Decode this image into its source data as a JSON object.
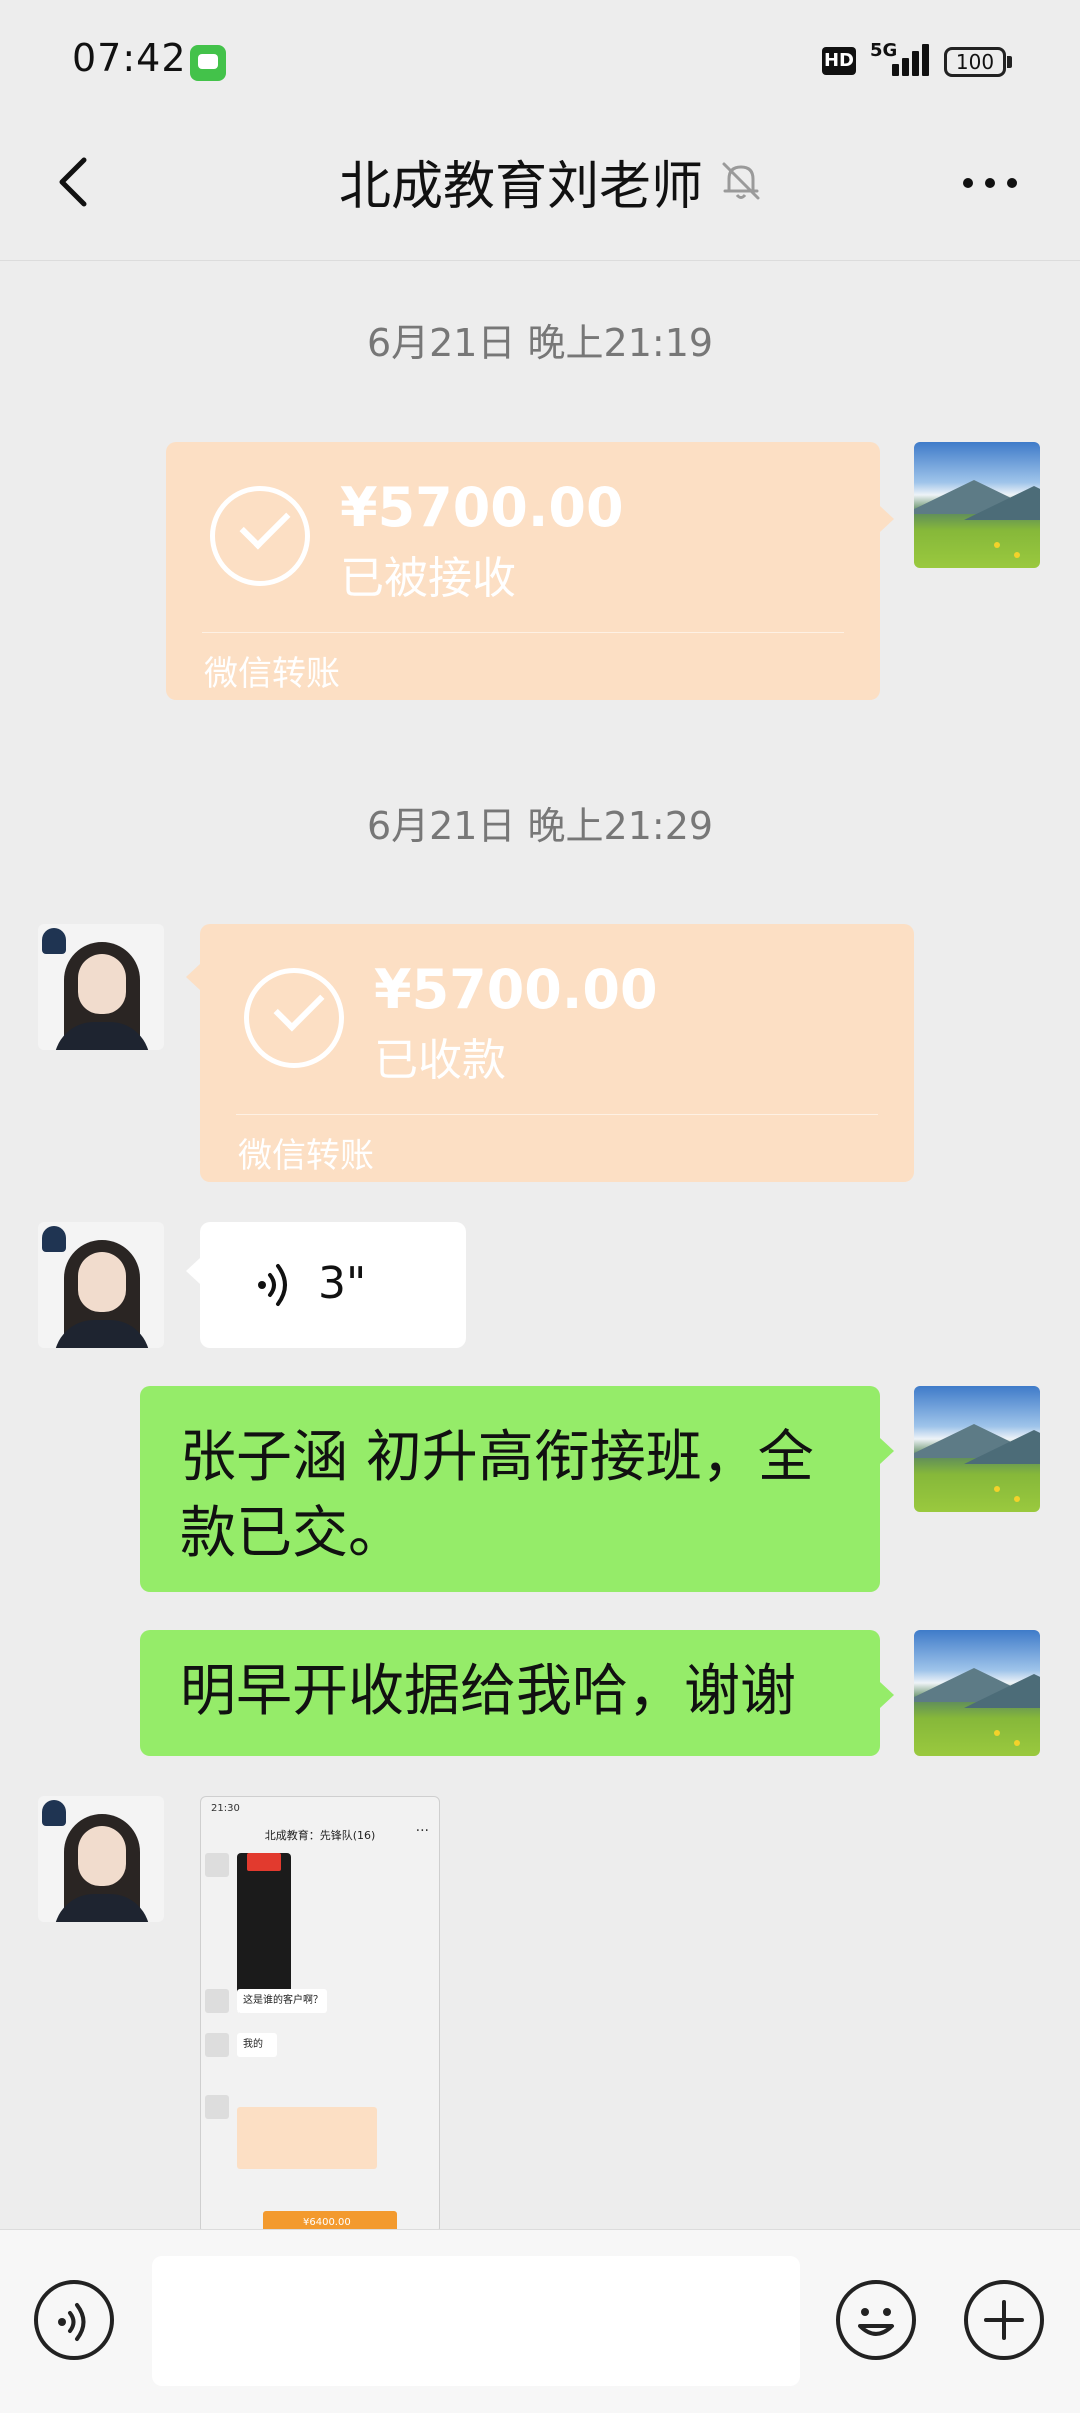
{
  "status_bar": {
    "time": "07:42",
    "hd_label": "HD",
    "network": "5G",
    "battery": "100"
  },
  "header": {
    "title": "北成教育刘老师",
    "back_icon": "chevron-left-icon",
    "mute_icon": "bell-off-icon",
    "more_icon": "more-horizontal-icon"
  },
  "messages": [
    {
      "type": "timestamp",
      "text": "6月21日 晚上21:19"
    },
    {
      "type": "transfer",
      "side": "right",
      "amount": "¥5700.00",
      "status": "已被接收",
      "footer": "微信转账"
    },
    {
      "type": "timestamp",
      "text": "6月21日 晚上21:29"
    },
    {
      "type": "transfer",
      "side": "left",
      "amount": "¥5700.00",
      "status": "已收款",
      "footer": "微信转账"
    },
    {
      "type": "voice",
      "side": "left",
      "duration": "3\""
    },
    {
      "type": "text",
      "side": "right",
      "lines": [
        "张子涵 初升高衔接班，全",
        "款已交。"
      ]
    },
    {
      "type": "text",
      "side": "right",
      "lines": [
        "明早开收据给我哈，谢谢"
      ]
    },
    {
      "type": "image",
      "side": "left",
      "thumbnail": {
        "time": "21:30",
        "title": "北成教育：先锋队(16)",
        "more": "···",
        "bubble_1": "这是谁的客户啊？",
        "bubble_2": "我的",
        "transfer_amount": "¥6400.00"
      }
    }
  ],
  "input_bar": {
    "voice_icon": "voice-input-icon",
    "emoji_icon": "emoji-icon",
    "plus_icon": "plus-icon"
  },
  "colors": {
    "background": "#ededed",
    "transfer_bubble": "#fcdfc4",
    "sent_bubble": "#95ec69",
    "received_bubble": "#ffffff"
  }
}
